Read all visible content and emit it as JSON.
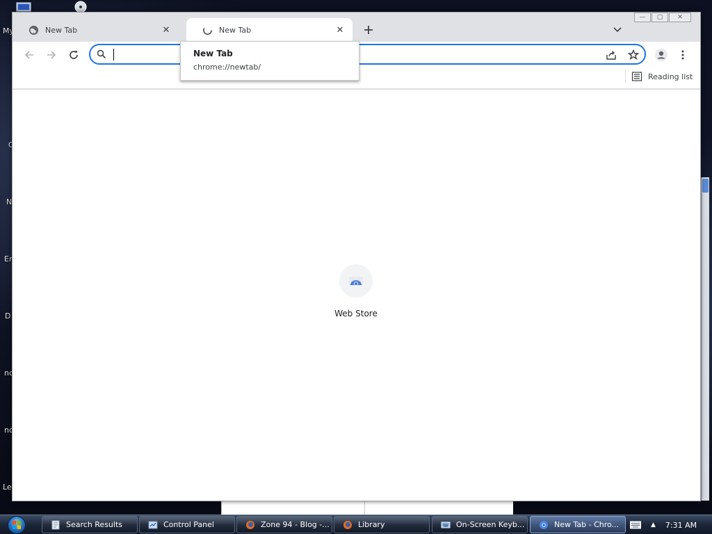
{
  "desktop": {
    "labels": [
      "My",
      "C",
      "N",
      "Er",
      "D",
      "nc",
      "nc",
      "Le"
    ]
  },
  "browser": {
    "tabs": [
      {
        "title": "New Tab",
        "active": false
      },
      {
        "title": "New Tab",
        "active": true
      }
    ],
    "omnibox": {
      "value": "",
      "placeholder": ""
    },
    "bookmarks_bar": {
      "reading_list": "Reading list"
    },
    "tooltip": {
      "title": "New Tab",
      "url": "chrome://newtab/"
    },
    "content": {
      "shortcuts": [
        {
          "label": "Web Store"
        }
      ]
    },
    "accent_color": "#1a73e8"
  },
  "taskbar": {
    "items": [
      {
        "label": "Search Results",
        "icon": "search-results-icon",
        "active": false
      },
      {
        "label": "Control Panel",
        "icon": "control-panel-icon",
        "active": false
      },
      {
        "label": "Zone 94 - Blog -...",
        "icon": "firefox-icon",
        "active": false
      },
      {
        "label": "Library",
        "icon": "firefox-icon",
        "active": false
      },
      {
        "label": "On-Screen Keyb...",
        "icon": "keyboard-icon",
        "active": false
      },
      {
        "label": "New Tab - Chro...",
        "icon": "chrome-icon",
        "active": true
      }
    ],
    "clock": "7:31 AM"
  }
}
